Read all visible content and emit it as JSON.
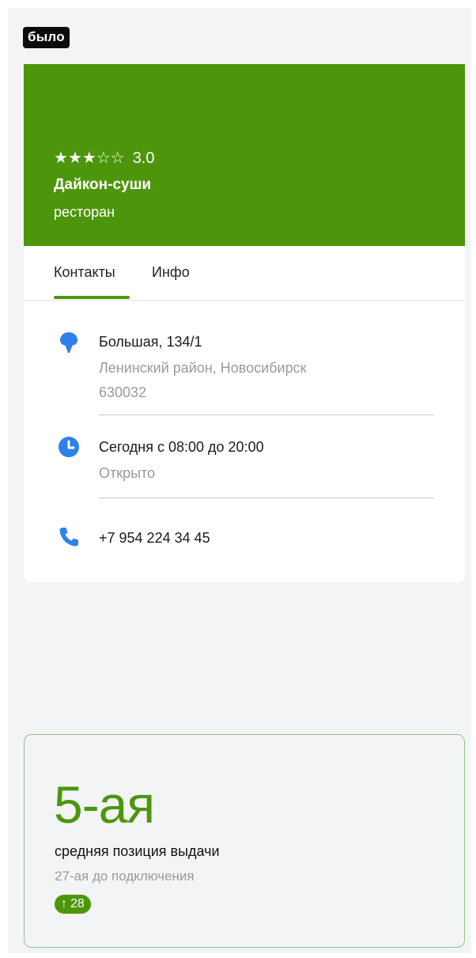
{
  "badge": "было",
  "colors": {
    "brand_green": "#4d960b",
    "icon_blue": "#2f80ed",
    "page_bg": "#f3f4f6"
  },
  "place": {
    "rating": {
      "value": "3.0",
      "stars_filled": 3,
      "stars_total": 5
    },
    "name": "Дайкон-суши",
    "type": "ресторан"
  },
  "tabs": [
    {
      "label": "Контакты",
      "active": true
    },
    {
      "label": "Инфо",
      "active": false
    }
  ],
  "contacts": {
    "address": {
      "icon": "location-pin-icon",
      "line1": "Большая, 134/1",
      "line2": "Ленинский район, Новосибирск",
      "line3": "630032"
    },
    "hours": {
      "icon": "clock-icon",
      "line1": "Сегодня с 08:00 до 20:00",
      "line2": "Открыто"
    },
    "phone": {
      "icon": "phone-icon",
      "line1": "+7 954 224 34 45"
    }
  },
  "stat": {
    "value": "5-ая",
    "label": "средняя позиция выдачи",
    "before": "27-ая до подключения",
    "change": {
      "arrow": "↑",
      "value": "28"
    }
  }
}
